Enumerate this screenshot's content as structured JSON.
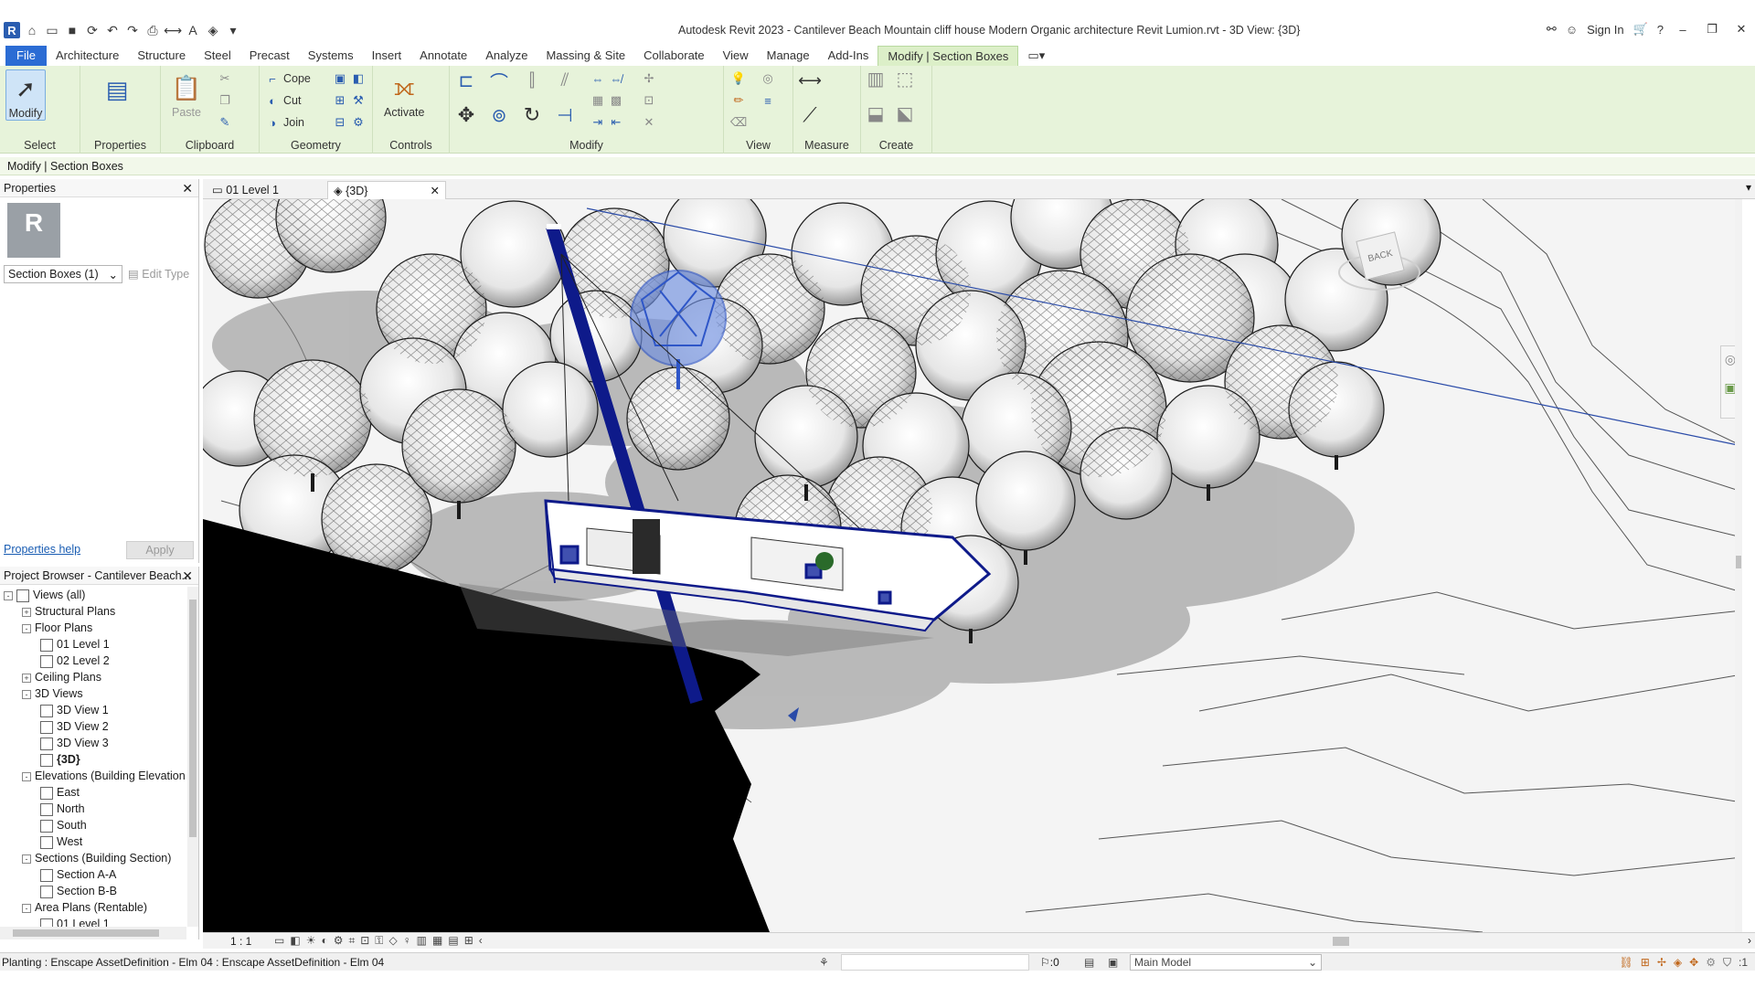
{
  "titlebar": {
    "title": "Autodesk Revit 2023 - Cantilever Beach Mountain cliff house  Modern Organic architecture  Revit Lumion.rvt - 3D View: {3D}",
    "sign_in": "Sign In",
    "logo_letter": "R"
  },
  "ribbon_tabs": [
    "File",
    "Architecture",
    "Structure",
    "Steel",
    "Precast",
    "Systems",
    "Insert",
    "Annotate",
    "Analyze",
    "Massing & Site",
    "Collaborate",
    "View",
    "Manage",
    "Add-Ins",
    "Modify | Section Boxes"
  ],
  "ribbon": {
    "modify_label": "Modify",
    "select_label": "Select",
    "properties_label": "Properties",
    "paste_label": "Paste",
    "clipboard_label": "Clipboard",
    "cope_label": "Cope",
    "cut_label": "Cut",
    "join_label": "Join",
    "geometry_label": "Geometry",
    "activate_label": "Activate",
    "controls_label": "Controls",
    "modify_group_label": "Modify",
    "view_label": "View",
    "measure_label": "Measure",
    "create_label": "Create"
  },
  "context_bar": "Modify | Section Boxes",
  "properties": {
    "title": "Properties",
    "type_selector": "Section Boxes (1)",
    "edit_type": "Edit Type",
    "help_link": "Properties help",
    "apply": "Apply"
  },
  "browser": {
    "title": "Project Browser - Cantilever Beach...",
    "nodes": [
      {
        "label": "Views (all)",
        "level": 0,
        "toggle": "-",
        "kind": "root"
      },
      {
        "label": "Structural Plans",
        "level": 1,
        "toggle": "+",
        "kind": "folder"
      },
      {
        "label": "Floor Plans",
        "level": 1,
        "toggle": "-",
        "kind": "folder"
      },
      {
        "label": "01 Level 1",
        "level": 2,
        "toggle": "",
        "kind": "view"
      },
      {
        "label": "02 Level 2",
        "level": 2,
        "toggle": "",
        "kind": "view"
      },
      {
        "label": "Ceiling Plans",
        "level": 1,
        "toggle": "+",
        "kind": "folder"
      },
      {
        "label": "3D Views",
        "level": 1,
        "toggle": "-",
        "kind": "folder"
      },
      {
        "label": "3D View 1",
        "level": 2,
        "toggle": "",
        "kind": "view"
      },
      {
        "label": "3D View 2",
        "level": 2,
        "toggle": "",
        "kind": "view"
      },
      {
        "label": "3D View 3",
        "level": 2,
        "toggle": "",
        "kind": "view"
      },
      {
        "label": "{3D}",
        "level": 2,
        "toggle": "",
        "kind": "view",
        "bold": true
      },
      {
        "label": "Elevations (Building Elevation",
        "level": 1,
        "toggle": "-",
        "kind": "folder"
      },
      {
        "label": "East",
        "level": 2,
        "toggle": "",
        "kind": "view"
      },
      {
        "label": "North",
        "level": 2,
        "toggle": "",
        "kind": "view"
      },
      {
        "label": "South",
        "level": 2,
        "toggle": "",
        "kind": "view"
      },
      {
        "label": "West",
        "level": 2,
        "toggle": "",
        "kind": "view"
      },
      {
        "label": "Sections (Building Section)",
        "level": 1,
        "toggle": "-",
        "kind": "folder"
      },
      {
        "label": "Section A-A",
        "level": 2,
        "toggle": "",
        "kind": "view"
      },
      {
        "label": "Section B-B",
        "level": 2,
        "toggle": "",
        "kind": "view"
      },
      {
        "label": "Area Plans (Rentable)",
        "level": 1,
        "toggle": "-",
        "kind": "folder"
      },
      {
        "label": "01 Level 1",
        "level": 2,
        "toggle": "",
        "kind": "view"
      }
    ]
  },
  "view_tabs": [
    "01 Level 1",
    "{3D}"
  ],
  "viewcube_label": "BACK",
  "view_control": {
    "scale": "1 : 1"
  },
  "status": {
    "text": "Planting : Enscape AssetDefinition - Elm 04 : Enscape AssetDefinition - Elm 04",
    "zero": ":0",
    "model": "Main Model",
    "filter_count": ":1"
  },
  "colors": {
    "file_tab": "#2b6cd4",
    "ribbon_bg": "#e7f3da",
    "selection_blue": "#1f3fa8"
  }
}
